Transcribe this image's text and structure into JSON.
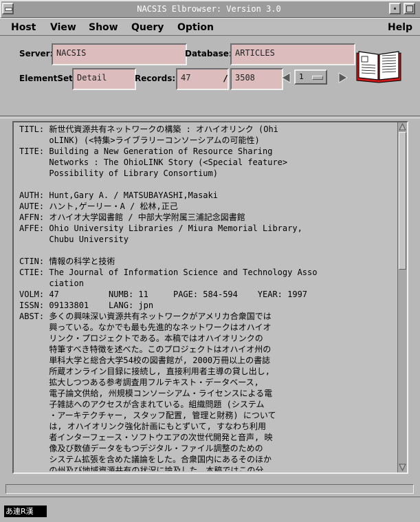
{
  "window": {
    "title": "NACSIS Elbrowser: Version 3.0"
  },
  "menu": {
    "host": "Host",
    "view": "View",
    "show": "Show",
    "query": "Query",
    "option": "Option",
    "help": "Help"
  },
  "form": {
    "server_label": "Server:",
    "server_value": "NACSIS",
    "database_label": "Database:",
    "database_value": "ARTICLES",
    "elementset_label": "ElementSet:",
    "elementset_value": "Detail",
    "records_label": "Records:",
    "records_current": "47",
    "records_separator": "/",
    "records_total": "3508",
    "page_value": "1"
  },
  "record": {
    "lines": [
      "TITL: 新世代資源共有ネットワークの構築 : オハイオリンク (Ohi",
      "      oLINK) (<特集>ライブラリーコンソーシアムの可能性)",
      "TITE: Building a New Generation of Resource Sharing",
      "      Networks : The OhioLINK Story (<Special feature>",
      "      Possibility of Library Consortium)",
      "",
      "AUTH: Hunt,Gary A. / MATSUBAYASHI,Masaki",
      "AUTE: ハント,ゲーリー・A / 松林,正己",
      "AFFN: オハイオ大学図書館 / 中部大学附属三浦記念図書館",
      "AFFE: Ohio University Libraries / Miura Memorial Library,",
      "      Chubu University",
      "",
      "CTIN: 情報の科学と技術",
      "CTIE: The Journal of Information Science and Technology Asso",
      "      ciation",
      "VOLM: 47          NUMB: 11     PAGE: 584-594    YEAR: 1997",
      "ISSN: 09133801    LANG: jpn",
      "ABST: 多くの興味深い資源共有ネットワークがアメリカ合衆国では",
      "      興っている。なかでも最も先進的なネットワークはオハイオ",
      "      リンク・プロジェクトである。本稿ではオハイオリンクの",
      "      特筆すべき特徴を述べた。このプロジェクトはオハイオ州の",
      "      単科大学と総合大学54校の図書館が, 2000万冊以上の書誌",
      "      所蔵オンライン目録に接続し, 直接利用者主導の貸し出し,",
      "      拡大しつつある参考調査用フルテキスト・データベース,",
      "      電子論文供給, 州規模コンソーシアム・ライセンスによる電",
      "      子雑誌へのアクセスが含まれている。組織問題 (システム",
      "      ・アーキテクチャー, スタッフ配置, 管理と財務) について",
      "      は, オハイオリンク強化計画にもとずいて, すなわち利用",
      "      者インターフェース・ソフトウエアの次世代開発と音声, 映",
      "      像及び数値データをもつデジタル・ファイル調整のための",
      "      システム拡張を含めた議論をした。合衆国内にあるそのほか",
      "      の州及び地域資源共有の状況に論及した。本稿ではこの分"
    ]
  },
  "ime": {
    "status": "あ連R漢"
  }
}
